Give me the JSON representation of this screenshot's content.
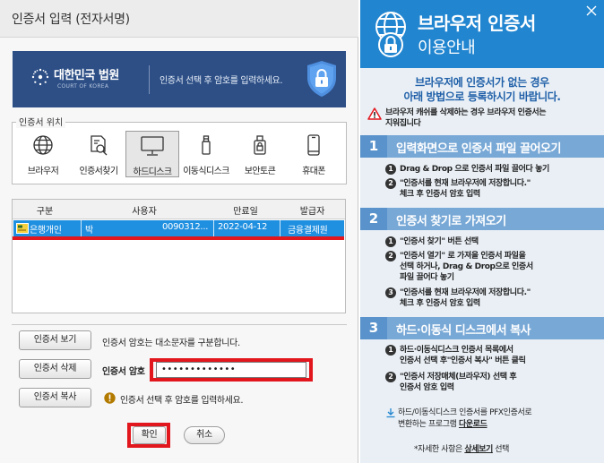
{
  "dialog": {
    "title": "인증서 입력 (전자서명)",
    "banner": {
      "logo_text": "대한민국 법원",
      "logo_sub": "COURT OF KOREA",
      "message": "인증서 선택 후 암호를 입력하세요."
    },
    "location": {
      "legend": "인증서 위치",
      "items": [
        {
          "label": "브라우저",
          "icon": "globe-icon"
        },
        {
          "label": "인증서찾기",
          "icon": "search-document-icon"
        },
        {
          "label": "하드디스크",
          "icon": "monitor-icon",
          "selected": true
        },
        {
          "label": "이동식디스크",
          "icon": "usb-icon"
        },
        {
          "label": "보안토큰",
          "icon": "security-token-icon"
        },
        {
          "label": "휴대폰",
          "icon": "mobile-phone-icon"
        }
      ]
    },
    "table": {
      "headers": [
        "구분",
        "사용자",
        "만료일",
        "발급자"
      ],
      "rows": [
        {
          "type": "은행개인",
          "user": "박",
          "user_id": "0090312...",
          "expiry": "2022-04-12",
          "issuer": "금융결제원"
        }
      ]
    },
    "buttons": {
      "view": "인증서 보기",
      "delete": "인증서 삭제",
      "copy": "인증서 복사",
      "ok": "확인",
      "cancel": "취소"
    },
    "info_text": "인증서 암호는 대소문자를 구분합니다.",
    "password": {
      "label": "인증서 암호",
      "value": "•••••••••••••"
    },
    "warning_text": "인증서 선택 후 암호를 입력하세요."
  },
  "help": {
    "title_line1": "브라우저 인증서",
    "title_line2": "이용안내",
    "intro_line1": "브라우저에 인증서가 없는 경우",
    "intro_line2": "아래 방법으로 등록하시기 바랍니다.",
    "warning_line1": "브라우저 캐쉬를 삭제하는 경우 브라우저 인증서는",
    "warning_line2": "지워집니다",
    "sections": [
      {
        "num": "1",
        "title": "입력화면으로 인증서 파일 끌어오기",
        "steps": [
          {
            "n": "1",
            "lines": [
              "Drag & Drop 으로 인증서 파일 끌어다 놓기"
            ]
          },
          {
            "n": "2",
            "lines": [
              "\"인증서를 현재 브라우저에 저장합니다.\"",
              "체크 후 인증서 암호 입력"
            ]
          }
        ]
      },
      {
        "num": "2",
        "title": "인증서 찾기로 가져오기",
        "steps": [
          {
            "n": "1",
            "lines": [
              "\"인증서 찾기\" 버튼 선택"
            ]
          },
          {
            "n": "2",
            "lines": [
              "\"인증서 열기\" 로 가져올 인증서 파일을",
              "선택 하거나, Drag & Drop으로 인증서",
              "파일 끌어다 놓기"
            ]
          },
          {
            "n": "3",
            "lines": [
              "\"인증서를 현재 브라우저에 저장합니다.\"",
              "체크 후 인증서 암호 입력"
            ]
          }
        ]
      },
      {
        "num": "3",
        "title": "하드·이동식 디스크에서 복사",
        "steps": [
          {
            "n": "1",
            "lines": [
              "하드·이동식디스크 인증서 목록에서",
              "인증서 선택 후\"인증서 복사\" 버튼 클릭"
            ]
          },
          {
            "n": "2",
            "lines": [
              "\"인증서 저장매체(브라우저) 선택 후",
              "인증서 암호 입력"
            ]
          }
        ]
      }
    ],
    "download_line1": "하드/이동식디스크 인증서를 PFX인증서로",
    "download_line2_prefix": "변환하는 프로그램 ",
    "download_link": "다운로드",
    "more_prefix": "*자세한 사항은 ",
    "more_link": "상세보기",
    "more_suffix": " 선택"
  },
  "colors": {
    "banner_bg": "#2d4f86",
    "help_header": "#2185d0",
    "section_head": "#78a8d6",
    "selected_row": "#1f8fe0",
    "highlight_red": "#e2161d"
  }
}
